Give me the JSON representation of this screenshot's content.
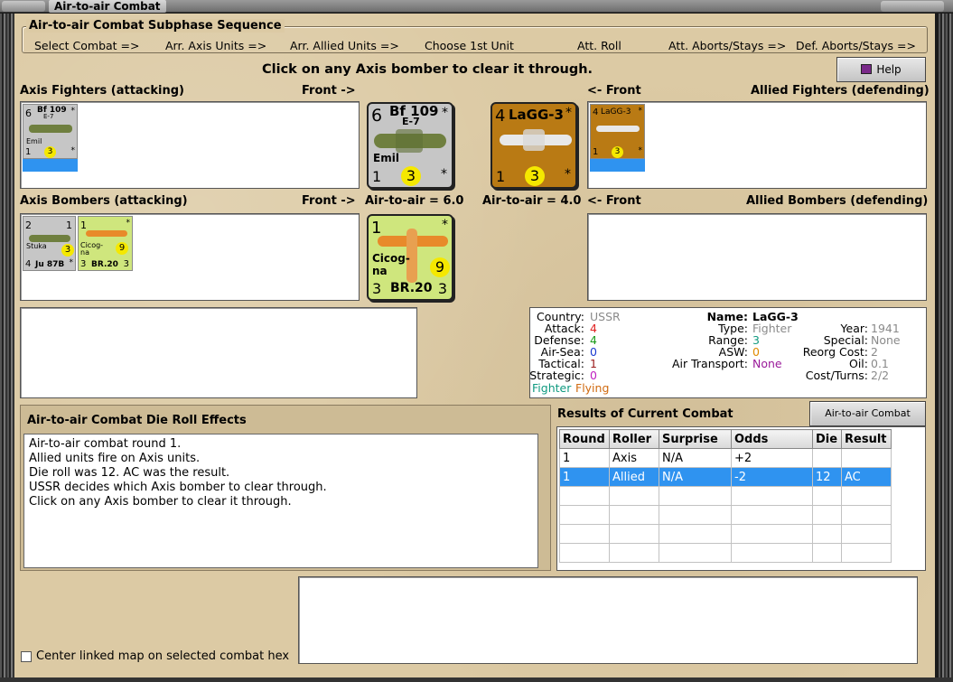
{
  "window": {
    "title": "Air-to-air Combat"
  },
  "subphase": {
    "title": "Air-to-air Combat Subphase Sequence",
    "steps": [
      "Select Combat =>",
      "Arr. Axis Units =>",
      "Arr. Allied Units =>",
      "Choose 1st Unit",
      "Att. Roll",
      "Att. Aborts/Stays =>",
      "Def. Aborts/Stays =>"
    ]
  },
  "instruction": "Click on any Axis bomber to clear it through.",
  "help_button": "Help",
  "labels": {
    "axis_fighters": "Axis Fighters (attacking)",
    "axis_fighters_front": "Front ->",
    "allied_fighters_front": "<- Front",
    "allied_fighters": "Allied Fighters (defending)",
    "axis_bombers": "Axis Bombers (attacking)",
    "axis_bombers_front": "Front ->",
    "axis_air_to_air": "Air-to-air = 6.0",
    "allied_air_to_air": "Air-to-air = 4.0",
    "allied_bombers_front": "<- Front",
    "allied_bombers": "Allied Bombers (defending)"
  },
  "units": {
    "bf109": {
      "top_left": "6",
      "name": "Bf 109",
      "variant": "E-7",
      "nickname": "Emil",
      "bottom_left": "1",
      "circle": "3",
      "star": "*"
    },
    "lagg3": {
      "top_left": "4",
      "name": "LaGG-3",
      "bottom_left": "1",
      "circle": "3",
      "star": "*"
    },
    "br20": {
      "top_left": "1",
      "name_line1": "Cicog-",
      "name_line2": "na",
      "name": "BR.20",
      "bottom_left": "3",
      "bottom_right": "3",
      "circle": "9",
      "star": "*"
    },
    "ju87": {
      "top_left": "2",
      "top_right": "1",
      "nickname": "Stuka",
      "name": "Ju 87B",
      "bottom_left": "4",
      "circle": "3",
      "star": "*"
    }
  },
  "info": {
    "country_label": "Country:",
    "country": "USSR",
    "attack_label": "Attack:",
    "attack": "4",
    "defense_label": "Defense:",
    "defense": "4",
    "air_sea_label": "Air-Sea:",
    "air_sea": "0",
    "tactical_label": "Tactical:",
    "tactical": "1",
    "strategic_label": "Strategic:",
    "strategic": "0",
    "class1": "Fighter",
    "class2": "Flying",
    "name_label": "Name:",
    "name": "LaGG-3",
    "type_label": "Type:",
    "type": "Fighter",
    "range_label": "Range:",
    "range": "3",
    "asw_label": "ASW:",
    "asw": "0",
    "air_transport_label": "Air Transport:",
    "air_transport": "None",
    "year_label": "Year:",
    "year": "1941",
    "special_label": "Special:",
    "special": "None",
    "reorg_label": "Reorg Cost:",
    "reorg": "2",
    "oil_label": "Oil:",
    "oil": "0.1",
    "cost_label": "Cost/Turns:",
    "cost": "2/2"
  },
  "die_effects": {
    "title": "Air-to-air Combat Die Roll Effects",
    "lines": [
      "Air-to-air combat round 1.",
      "Allied units fire on Axis units.",
      "Die roll was 12.  AC was the result.",
      "USSR decides which Axis bomber to clear through.",
      "Click on any Axis bomber to clear it through."
    ]
  },
  "results": {
    "title": "Results of Current Combat",
    "chart_button": "Air-to-air Combat Chart",
    "columns": [
      "Round",
      "Roller",
      "Surprise",
      "Odds",
      "Die",
      "Result"
    ],
    "rows": [
      [
        "1",
        "Axis",
        "N/A",
        "+2",
        "",
        ""
      ],
      [
        "1",
        "Allied",
        "N/A",
        "-2",
        "12",
        "AC"
      ]
    ],
    "selected_row": 1
  },
  "center_map_label": "Center linked map on selected combat hex",
  "colors": {
    "attack": "#e02020",
    "defense": "#1a9a1a",
    "range": "#1a9a1a",
    "asw": "#e08a00",
    "purple": "#9a1a9a",
    "blue": "#1a3ad0",
    "gray": "#8a8a8a",
    "fighter": "#109a80",
    "flying": "#d06a10"
  }
}
